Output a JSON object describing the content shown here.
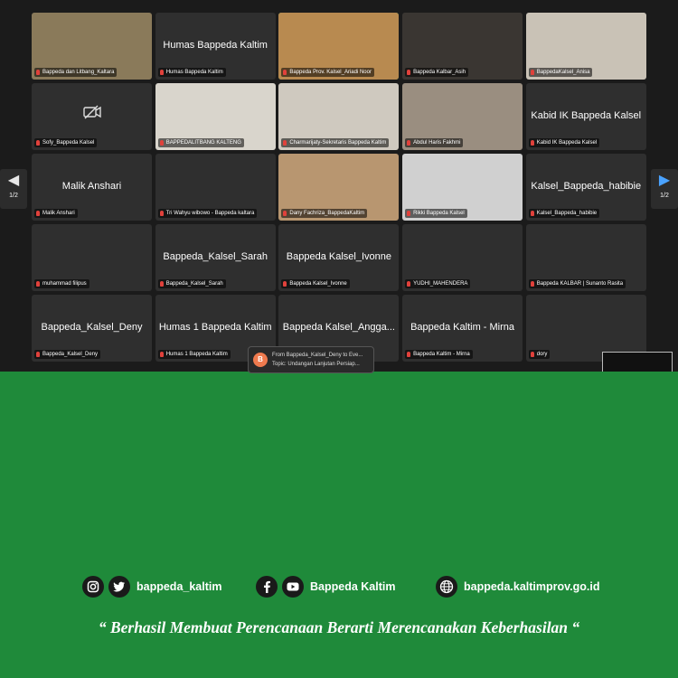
{
  "meeting": {
    "page_indicator_left": "1/2",
    "page_indicator_right": "1/2",
    "tiles": [
      {
        "label": "Bappeda dan Litbang_Kaltara",
        "center": "",
        "bg": "#8a7a5a"
      },
      {
        "label": "Humas Bappeda Kaltim",
        "center": "Humas Bappeda Kaltim",
        "bg": "#2f2f2f"
      },
      {
        "label": "Bappeda Prov. Kalsel_Ariadi Noor",
        "center": "",
        "bg": "#b88a50"
      },
      {
        "label": "Bappeda Kalbar_Asih",
        "center": "",
        "bg": "#3a3632"
      },
      {
        "label": "BappedaKalsel_Anisa",
        "center": "",
        "bg": "#c9c2b6"
      },
      {
        "label": "Sofy_Bappeda Kalsel",
        "center": "",
        "bg": "#2f2f2f"
      },
      {
        "label": "BAPPEDALITBANG KALTENG",
        "center": "",
        "bg": "#d9d5cc"
      },
      {
        "label": "Charmarijaty-Sekretaris Bappeda Kaltim",
        "center": "",
        "bg": "#cfc9bf"
      },
      {
        "label": "Abdul Haris Fakhmi",
        "center": "",
        "bg": "#9a8e80"
      },
      {
        "label": "Kabid IK Bappeda Kalsel",
        "center": "Kabid IK Bappeda Kalsel",
        "bg": "#2f2f2f"
      },
      {
        "label": "Malik Anshari",
        "center": "Malik Anshari",
        "bg": "#2f2f2f"
      },
      {
        "label": "Tri Wahyu wibowo - Bappeda kaltara",
        "center": "",
        "bg": "#2f2f2f"
      },
      {
        "label": "Dany Fachriza_BappedaKaltim",
        "center": "",
        "bg": "#b89670"
      },
      {
        "label": "Rikki Bappeda Kalsel",
        "center": "",
        "bg": "#d0d0d0"
      },
      {
        "label": "Kalsel_Bappeda_habibie",
        "center": "Kalsel_Bappeda_habibie",
        "bg": "#2f2f2f"
      },
      {
        "label": "muhammad filipus",
        "center": "",
        "bg": "#2f2f2f"
      },
      {
        "label": "Bappeda_Kalsel_Sarah",
        "center": "Bappeda_Kalsel_Sarah",
        "bg": "#2f2f2f"
      },
      {
        "label": "Bappeda Kalsel_Ivonne",
        "center": "Bappeda Kalsel_Ivonne",
        "bg": "#2f2f2f"
      },
      {
        "label": "YUDHI_MAHENDERA",
        "center": "",
        "bg": "#2f2f2f"
      },
      {
        "label": "Bappeda KALBAR | Sunanto Rasita",
        "center": "",
        "bg": "#2f2f2f"
      },
      {
        "label": "Bappeda_Kalsel_Deny",
        "center": "Bappeda_Kalsel_Deny",
        "bg": "#2f2f2f"
      },
      {
        "label": "Humas 1 Bappeda Kaltim",
        "center": "Humas 1 Bappeda Kaltim",
        "bg": "#2f2f2f"
      },
      {
        "label": "",
        "center": "Bappeda Kalsel_Angga...",
        "bg": "#2f2f2f"
      },
      {
        "label": "Bappeda Kaltim - Mirna",
        "center": "Bappeda Kaltim - Mirna",
        "bg": "#2f2f2f"
      },
      {
        "label": "dory",
        "center": "",
        "bg": "#2f2f2f"
      }
    ],
    "chat": {
      "avatar_letter": "B",
      "from": "From Bappeda_Kalsel_Deny to Eve...",
      "topic": "Topic: Undangan Lanjutan Persiap..."
    }
  },
  "footer": {
    "instagram_twitter_handle": "bappeda_kaltim",
    "facebook_youtube_name": "Bappeda Kaltim",
    "website": "bappeda.kaltimprov.go.id",
    "tagline": "“ Berhasil  Membuat Perencanaan Berarti Merencanakan Keberhasilan “",
    "colors": {
      "background": "#1f8a3a",
      "icon_circle": "#1a1a1a"
    },
    "icons": [
      "instagram-icon",
      "twitter-icon",
      "facebook-icon",
      "youtube-icon",
      "globe-icon"
    ]
  }
}
